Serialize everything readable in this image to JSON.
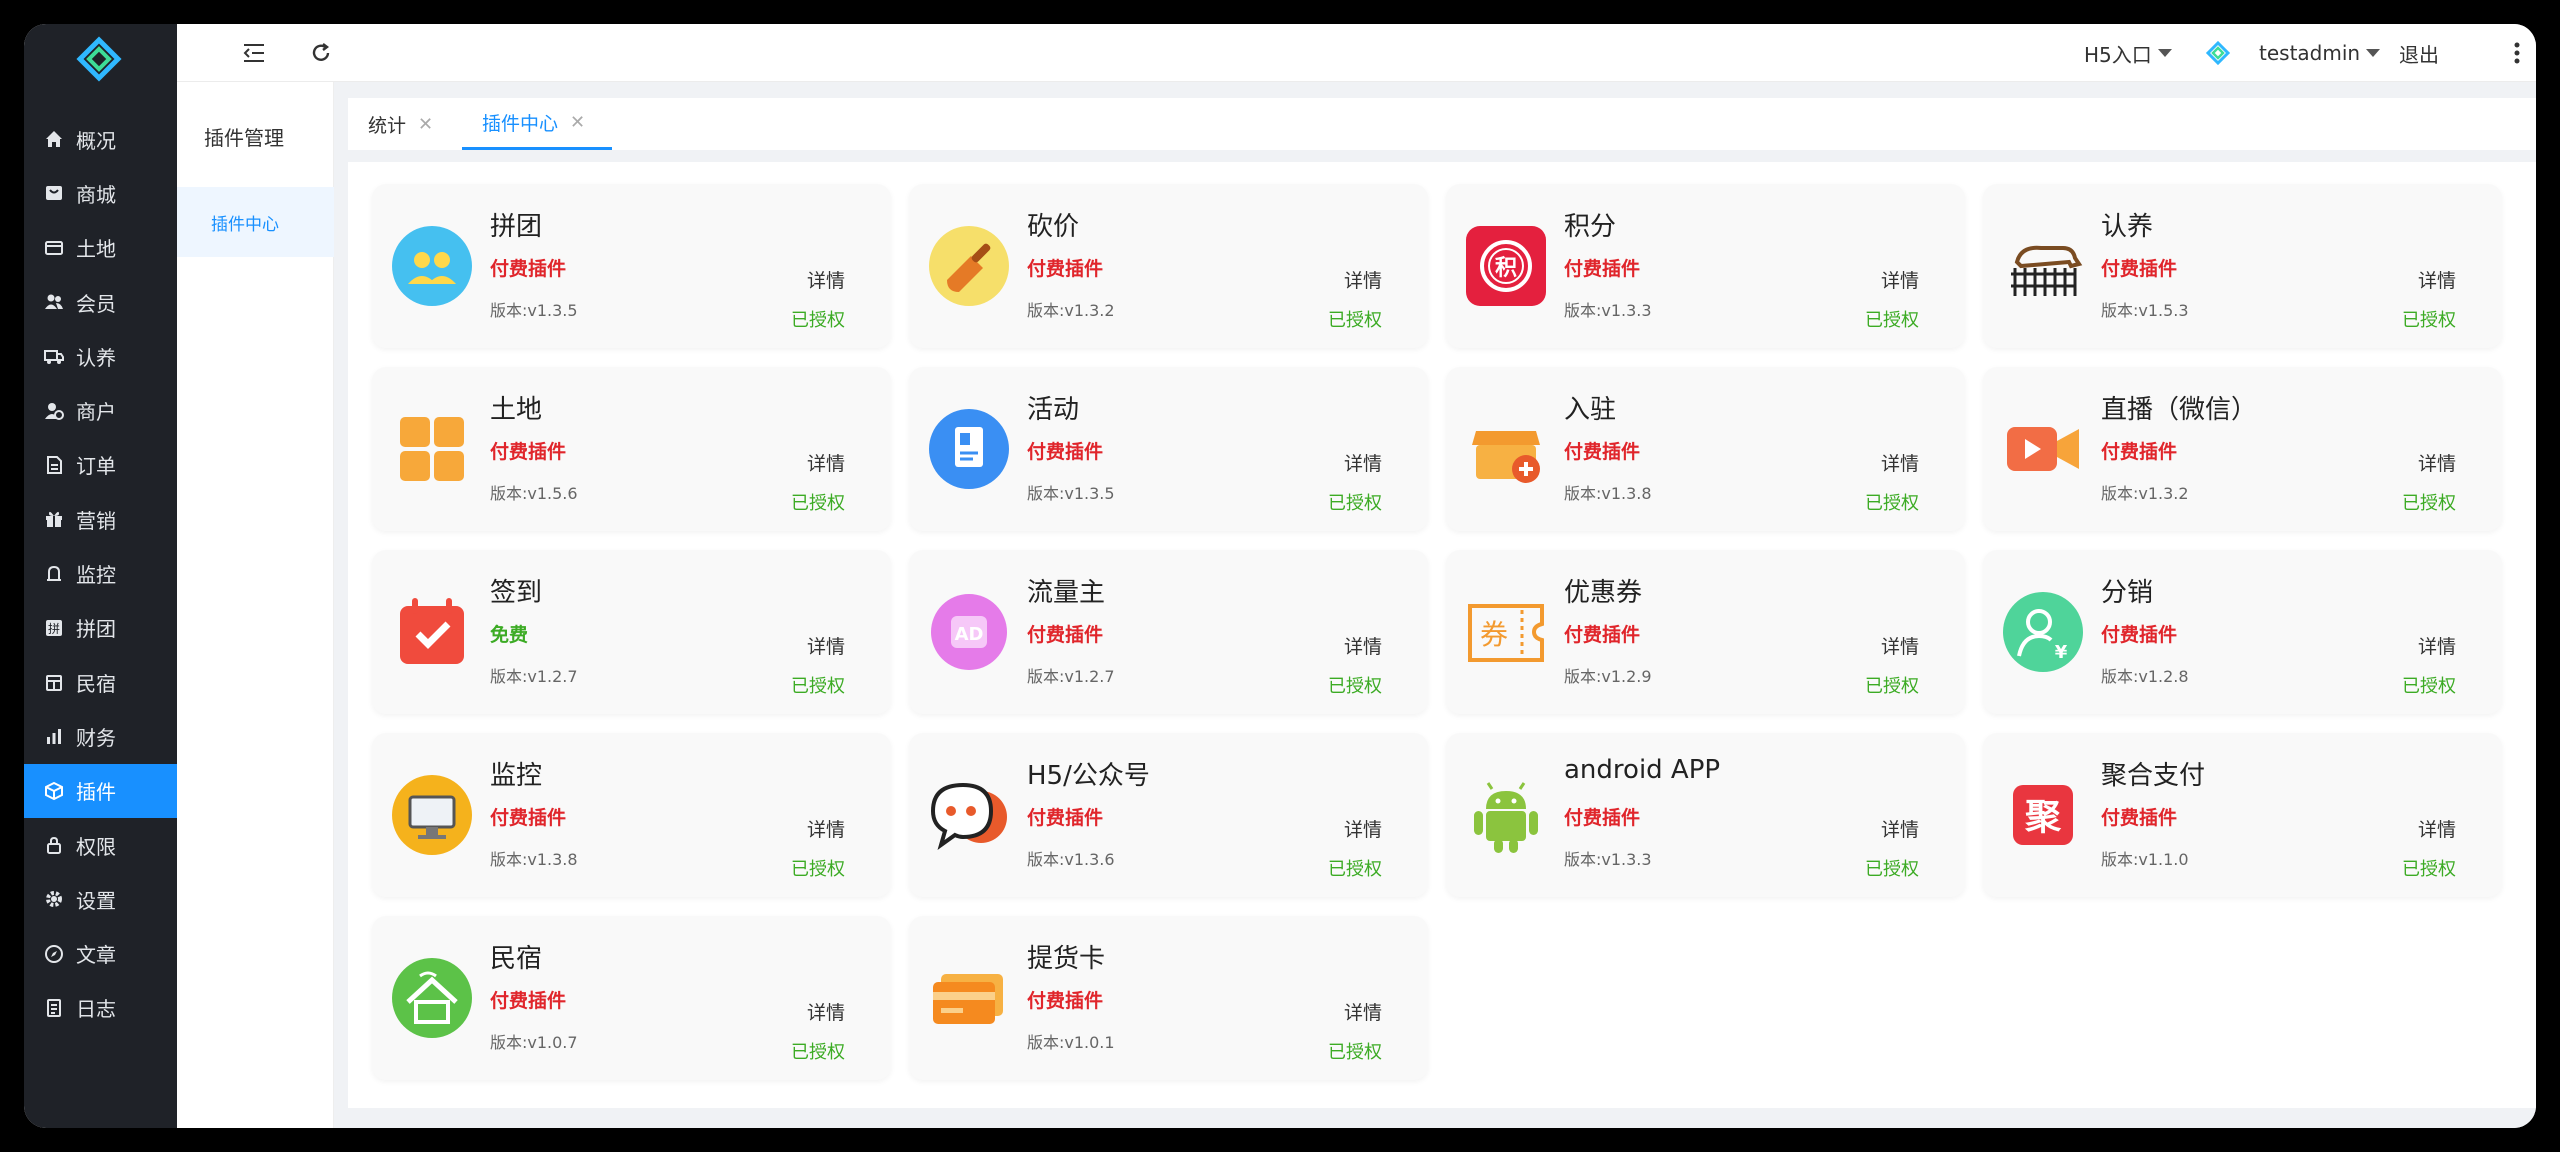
{
  "sidebar": {
    "items": [
      {
        "label": "概况",
        "icon": "home-icon"
      },
      {
        "label": "商城",
        "icon": "shop-icon"
      },
      {
        "label": "土地",
        "icon": "card-icon"
      },
      {
        "label": "会员",
        "icon": "users-icon"
      },
      {
        "label": "认养",
        "icon": "truck-icon"
      },
      {
        "label": "商户",
        "icon": "merchant-icon"
      },
      {
        "label": "订单",
        "icon": "order-icon"
      },
      {
        "label": "营销",
        "icon": "gift-icon"
      },
      {
        "label": "监控",
        "icon": "bell-icon"
      },
      {
        "label": "拼团",
        "icon": "group-icon"
      },
      {
        "label": "民宿",
        "icon": "house-icon"
      },
      {
        "label": "财务",
        "icon": "chart-icon"
      },
      {
        "label": "插件",
        "icon": "cube-icon"
      },
      {
        "label": "权限",
        "icon": "lock-icon"
      },
      {
        "label": "设置",
        "icon": "gear-icon"
      },
      {
        "label": "文章",
        "icon": "compass-icon"
      },
      {
        "label": "日志",
        "icon": "log-icon"
      }
    ],
    "active_index": 12
  },
  "header": {
    "h5_entry": "H5入口",
    "username": "testadmin",
    "logout": "退出"
  },
  "subside": {
    "title": "插件管理",
    "item": "插件中心"
  },
  "tabs": [
    {
      "label": "统计"
    },
    {
      "label": "插件中心"
    }
  ],
  "common": {
    "detail": "详情",
    "authorized": "已授权"
  },
  "plugins": [
    {
      "title": "拼团",
      "type": "付费插件",
      "version": "版本:v1.3.5",
      "icon": "group-buy-icon"
    },
    {
      "title": "砍价",
      "type": "付费插件",
      "version": "版本:v1.3.2",
      "icon": "bargain-icon"
    },
    {
      "title": "积分",
      "type": "付费插件",
      "version": "版本:v1.3.3",
      "icon": "points-icon"
    },
    {
      "title": "认养",
      "type": "付费插件",
      "version": "版本:v1.5.3",
      "icon": "adoption-icon"
    },
    {
      "title": "土地",
      "type": "付费插件",
      "version": "版本:v1.5.6",
      "icon": "land-icon"
    },
    {
      "title": "活动",
      "type": "付费插件",
      "version": "版本:v1.3.5",
      "icon": "activity-icon"
    },
    {
      "title": "入驻",
      "type": "付费插件",
      "version": "版本:v1.3.8",
      "icon": "settle-in-icon"
    },
    {
      "title": "直播（微信）",
      "type": "付费插件",
      "version": "版本:v1.3.2",
      "icon": "live-icon"
    },
    {
      "title": "签到",
      "type": "免费",
      "version": "版本:v1.2.7",
      "icon": "check-in-icon",
      "free": true
    },
    {
      "title": "流量主",
      "type": "付费插件",
      "version": "版本:v1.2.7",
      "icon": "ad-icon"
    },
    {
      "title": "优惠券",
      "type": "付费插件",
      "version": "版本:v1.2.9",
      "icon": "coupon-icon"
    },
    {
      "title": "分销",
      "type": "付费插件",
      "version": "版本:v1.2.8",
      "icon": "distribution-icon"
    },
    {
      "title": "监控",
      "type": "付费插件",
      "version": "版本:v1.3.8",
      "icon": "monitor-icon"
    },
    {
      "title": "H5/公众号",
      "type": "付费插件",
      "version": "版本:v1.3.6",
      "icon": "chat-icon"
    },
    {
      "title": "android APP",
      "type": "付费插件",
      "version": "版本:v1.3.3",
      "icon": "android-icon"
    },
    {
      "title": "聚合支付",
      "type": "付费插件",
      "version": "版本:v1.1.0",
      "icon": "payment-icon"
    },
    {
      "title": "民宿",
      "type": "付费插件",
      "version": "版本:v1.0.7",
      "icon": "homestay-icon"
    },
    {
      "title": "提货卡",
      "type": "付费插件",
      "version": "版本:v1.0.1",
      "icon": "pickup-card-icon"
    }
  ],
  "icon_glyphs": {
    "points": "积",
    "ad": "AD",
    "coupon": "券",
    "payment": "聚",
    "currency": "¥"
  },
  "colors": {
    "accent": "#1890ff",
    "sidebar_bg": "#1f2228",
    "paid": "#e0252b",
    "free": "#3cab24"
  }
}
